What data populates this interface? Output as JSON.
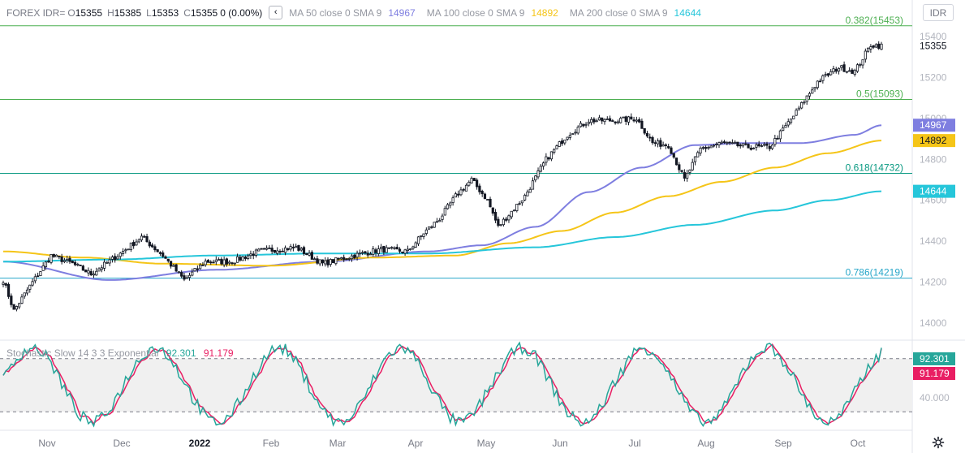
{
  "legend": {
    "symbol": "FOREX IDR=",
    "ohlc": [
      {
        "key": "O",
        "value": "15355"
      },
      {
        "key": "H",
        "value": "15385"
      },
      {
        "key": "L",
        "value": "15353"
      },
      {
        "key": "C",
        "value": "15355"
      }
    ],
    "change": "0 (0.00%)",
    "collapse_icon": "chevron-left-icon",
    "indicators": [
      {
        "name": "MA 50 close 0 SMA 9",
        "value": "14967",
        "color": "#7e7ee0"
      },
      {
        "name": "MA 100 close 0 SMA 9",
        "value": "14892",
        "color": "#f5c518"
      },
      {
        "name": "MA 200 close 0 SMA 9",
        "value": "14644",
        "color": "#26c6da"
      }
    ]
  },
  "symbol_box": "IDR",
  "settings_icon": "gear-icon",
  "stochastic": {
    "name": "Stochastic Slow 14 3 3 Exponential",
    "k_value": "92.301",
    "d_value": "91.179",
    "k_color": "#26a69a",
    "d_color": "#e91e63",
    "axis_label": "40.000",
    "upper_band": 80,
    "lower_band": 20,
    "range": [
      0,
      100
    ]
  },
  "chart_data": {
    "type": "candlestick",
    "y_ticks": [
      14000,
      14200,
      14400,
      14600,
      14800,
      15000,
      15200,
      15400
    ],
    "ylim": [
      13920,
      15480
    ],
    "x_labels": [
      "Nov",
      "Dec",
      "2022",
      "Feb",
      "Mar",
      "Apr",
      "May",
      "Jun",
      "Jul",
      "Aug",
      "Sep",
      "Oct"
    ],
    "last_price": "15355",
    "price_key_points": [
      [
        0,
        14210
      ],
      [
        4,
        14060
      ],
      [
        10,
        14180
      ],
      [
        18,
        14330
      ],
      [
        26,
        14290
      ],
      [
        33,
        14240
      ],
      [
        43,
        14330
      ],
      [
        52,
        14420
      ],
      [
        60,
        14330
      ],
      [
        68,
        14210
      ],
      [
        76,
        14300
      ],
      [
        86,
        14300
      ],
      [
        96,
        14350
      ],
      [
        110,
        14370
      ],
      [
        120,
        14290
      ],
      [
        132,
        14330
      ],
      [
        142,
        14360
      ],
      [
        152,
        14350
      ],
      [
        158,
        14440
      ],
      [
        164,
        14510
      ],
      [
        170,
        14620
      ],
      [
        176,
        14700
      ],
      [
        182,
        14600
      ],
      [
        186,
        14470
      ],
      [
        196,
        14620
      ],
      [
        204,
        14800
      ],
      [
        212,
        14920
      ],
      [
        220,
        14990
      ],
      [
        230,
        14990
      ],
      [
        238,
        15000
      ],
      [
        244,
        14880
      ],
      [
        250,
        14870
      ],
      [
        256,
        14700
      ],
      [
        262,
        14850
      ],
      [
        270,
        14880
      ],
      [
        280,
        14860
      ],
      [
        288,
        14860
      ],
      [
        298,
        15030
      ],
      [
        306,
        15180
      ],
      [
        314,
        15250
      ],
      [
        320,
        15230
      ],
      [
        326,
        15360
      ],
      [
        330,
        15355
      ]
    ],
    "fib_levels": [
      {
        "label": "0.382(15453)",
        "value": 15453,
        "color": "#4caf50"
      },
      {
        "label": "0.5(15093)",
        "value": 15093,
        "color": "#4caf50"
      },
      {
        "label": "0.618(14732)",
        "value": 14732,
        "color": "#089981"
      },
      {
        "label": "0.786(14219)",
        "value": 14219,
        "color": "#26a6c9"
      }
    ],
    "moving_averages": [
      {
        "name": "MA 50",
        "last": 14967,
        "color": "#7e7ee0",
        "label_bg": "#7e7ee0",
        "points": [
          [
            0,
            14300
          ],
          [
            40,
            14210
          ],
          [
            80,
            14260
          ],
          [
            120,
            14300
          ],
          [
            160,
            14350
          ],
          [
            180,
            14380
          ],
          [
            200,
            14470
          ],
          [
            220,
            14640
          ],
          [
            240,
            14760
          ],
          [
            260,
            14870
          ],
          [
            280,
            14880
          ],
          [
            300,
            14880
          ],
          [
            320,
            14920
          ],
          [
            330,
            14967
          ]
        ]
      },
      {
        "name": "MA 100",
        "last": 14892,
        "color": "#f5c518",
        "label_bg": "#f5c518",
        "points": [
          [
            0,
            14350
          ],
          [
            30,
            14320
          ],
          [
            60,
            14290
          ],
          [
            100,
            14280
          ],
          [
            140,
            14320
          ],
          [
            170,
            14330
          ],
          [
            190,
            14390
          ],
          [
            210,
            14450
          ],
          [
            230,
            14540
          ],
          [
            250,
            14620
          ],
          [
            270,
            14690
          ],
          [
            290,
            14760
          ],
          [
            310,
            14830
          ],
          [
            330,
            14892
          ]
        ]
      },
      {
        "name": "MA 200",
        "last": 14644,
        "color": "#26c6da",
        "label_bg": "#26c6da",
        "points": [
          [
            0,
            14300
          ],
          [
            40,
            14310
          ],
          [
            80,
            14330
          ],
          [
            120,
            14340
          ],
          [
            160,
            14340
          ],
          [
            200,
            14370
          ],
          [
            230,
            14420
          ],
          [
            260,
            14480
          ],
          [
            290,
            14550
          ],
          [
            310,
            14600
          ],
          [
            330,
            14644
          ]
        ]
      }
    ]
  }
}
